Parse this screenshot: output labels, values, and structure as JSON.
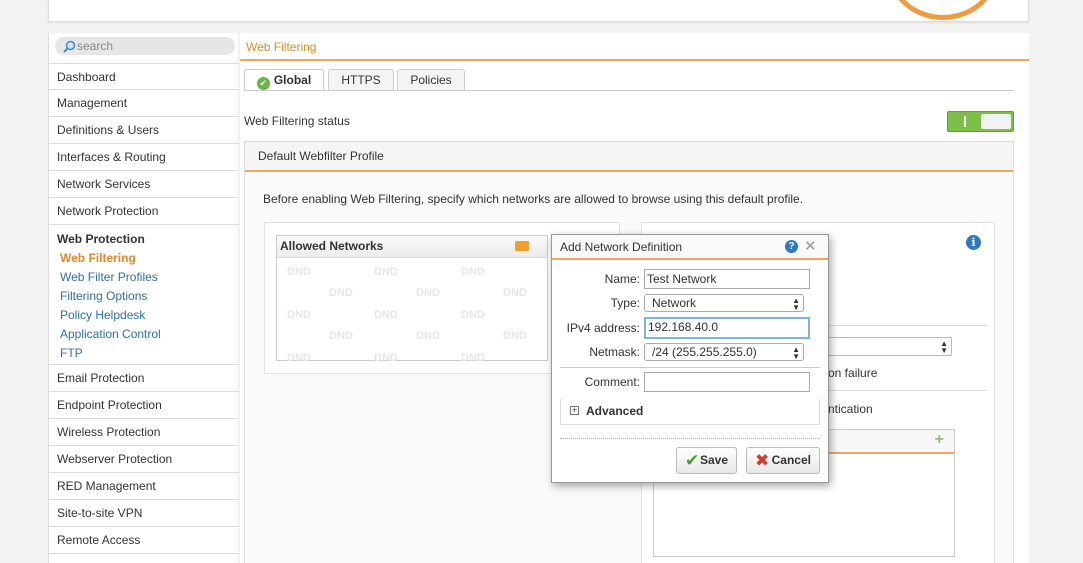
{
  "search": {
    "placeholder": "search"
  },
  "sidebar": {
    "items_top": [
      "Dashboard",
      "Management",
      "Definitions & Users",
      "Interfaces & Routing",
      "Network Services",
      "Network Protection"
    ],
    "group": {
      "title": "Web Protection",
      "subitems": [
        "Web Filtering",
        "Web Filter Profiles",
        "Filtering Options",
        "Policy Helpdesk",
        "Application Control",
        "FTP"
      ],
      "active": "Web Filtering"
    },
    "items_bottom": [
      "Email Protection",
      "Endpoint Protection",
      "Wireless Protection",
      "Webserver Protection",
      "RED Management",
      "Site-to-site VPN",
      "Remote Access"
    ]
  },
  "breadcrumb": "Web Filtering",
  "tabs": [
    "Global",
    "HTTPS",
    "Policies"
  ],
  "status": {
    "label": "Web Filtering status",
    "enabled": true
  },
  "section": {
    "title": "Default Webfilter Profile",
    "hint": "Before enabling Web Filtering, specify which networks are allowed to browse using this default profile.",
    "allowed_networks": {
      "title": "Allowed Networks",
      "watermark": "DND"
    },
    "right_panel": {
      "text1_partial": "on failure",
      "text2_partial": "ntication"
    }
  },
  "dialog": {
    "title": "Add Network Definition",
    "name_label": "Name:",
    "name_value": "Test Network",
    "type_label": "Type:",
    "type_value": "Network",
    "ipv4_label": "IPv4 address:",
    "ipv4_value": "192.168.40.0",
    "netmask_label": "Netmask:",
    "netmask_value": "/24 (255.255.255.0)",
    "comment_label": "Comment:",
    "comment_value": "",
    "advanced_label": "Advanced",
    "save_label": "Save",
    "cancel_label": "Cancel"
  },
  "colors": {
    "accent": "#f0a45c",
    "link": "#2f6fae",
    "active": "#e8872a",
    "toggle_on": "#7cc04a"
  }
}
